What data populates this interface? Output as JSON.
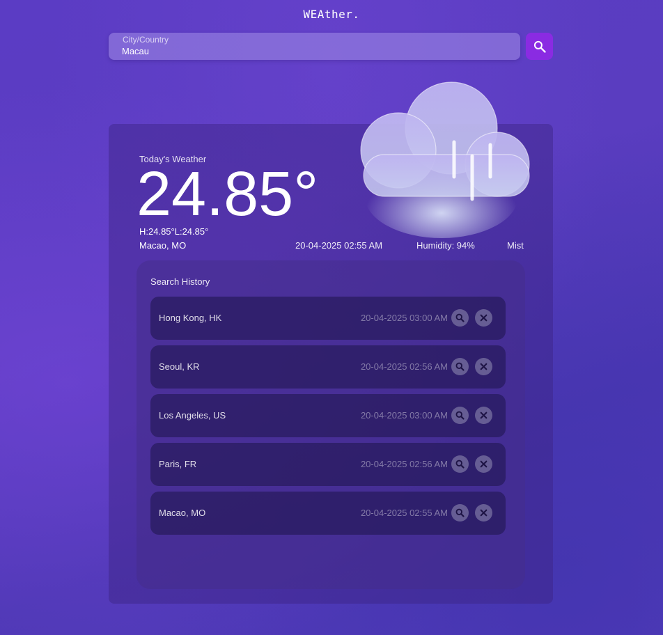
{
  "app": {
    "title": "WEAther."
  },
  "search": {
    "label": "City/Country",
    "value": "Macau"
  },
  "today": {
    "label": "Today's Weather",
    "temperature": "24.85°",
    "hilo": "H:24.85°L:24.85°",
    "city": "Macao, MO",
    "datetime": "20-04-2025 02:55 AM",
    "humidity": "Humidity: 94%",
    "condition": "Mist",
    "icon": "rain-cloud-icon"
  },
  "history": {
    "title": "Search History",
    "items": [
      {
        "city": "Hong Kong, HK",
        "time": "20-04-2025 03:00 AM"
      },
      {
        "city": "Seoul, KR",
        "time": "20-04-2025 02:56 AM"
      },
      {
        "city": "Los Angeles, US",
        "time": "20-04-2025 03:00 AM"
      },
      {
        "city": "Paris, FR",
        "time": "20-04-2025 02:56 AM"
      },
      {
        "city": "Macao, MO",
        "time": "20-04-2025 02:55 AM"
      }
    ]
  },
  "colors": {
    "accent": "#8a2be2",
    "background": "#5b3cc4"
  }
}
